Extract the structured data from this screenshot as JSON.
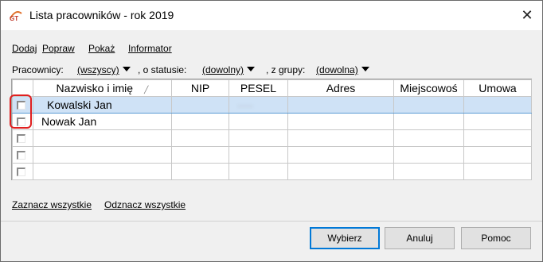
{
  "window": {
    "title": "Lista pracowników - rok 2019",
    "close_glyph": "✕",
    "app_icon": "gt-logo-icon"
  },
  "menu": {
    "items": [
      "Dodaj",
      "Popraw",
      "Pokaż",
      "Informator"
    ]
  },
  "filters": {
    "workers_label": "Pracownicy:",
    "workers_value": "(wszyscy)",
    "status_label": ", o statusie:",
    "status_value": "(dowolny)",
    "group_label": ", z grupy:",
    "group_value": "(dowolna)"
  },
  "table": {
    "columns": [
      "Nazwisko i imię",
      "NIP",
      "PESEL",
      "Adres",
      "Miejscowoś",
      "Umowa"
    ],
    "rows": [
      {
        "name": "Kowalski Jan",
        "nip": "",
        "pesel": "·····",
        "adres": "",
        "miejscowosc": "",
        "umowa": "",
        "selected": true
      },
      {
        "name": "Nowak Jan",
        "nip": "",
        "pesel": "",
        "adres": "",
        "miejscowosc": "",
        "umowa": "",
        "selected": false
      },
      {
        "name": "",
        "nip": "",
        "pesel": "",
        "adres": "",
        "miejscowosc": "",
        "umowa": "",
        "selected": false
      },
      {
        "name": "",
        "nip": "",
        "pesel": "",
        "adres": "",
        "miejscowosc": "",
        "umowa": "",
        "selected": false
      },
      {
        "name": "",
        "nip": "",
        "pesel": "",
        "adres": "",
        "miejscowosc": "",
        "umowa": "",
        "selected": false
      }
    ]
  },
  "bottom_links": {
    "select_all": "Zaznacz wszystkie",
    "deselect_all": "Odznacz wszystkie"
  },
  "buttons": {
    "choose": "Wybierz",
    "cancel": "Anuluj",
    "help": "Pomoc"
  },
  "colors": {
    "highlight_border": "#e02020",
    "selected_row": "#cfe2f6",
    "default_button_border": "#0078d7"
  }
}
